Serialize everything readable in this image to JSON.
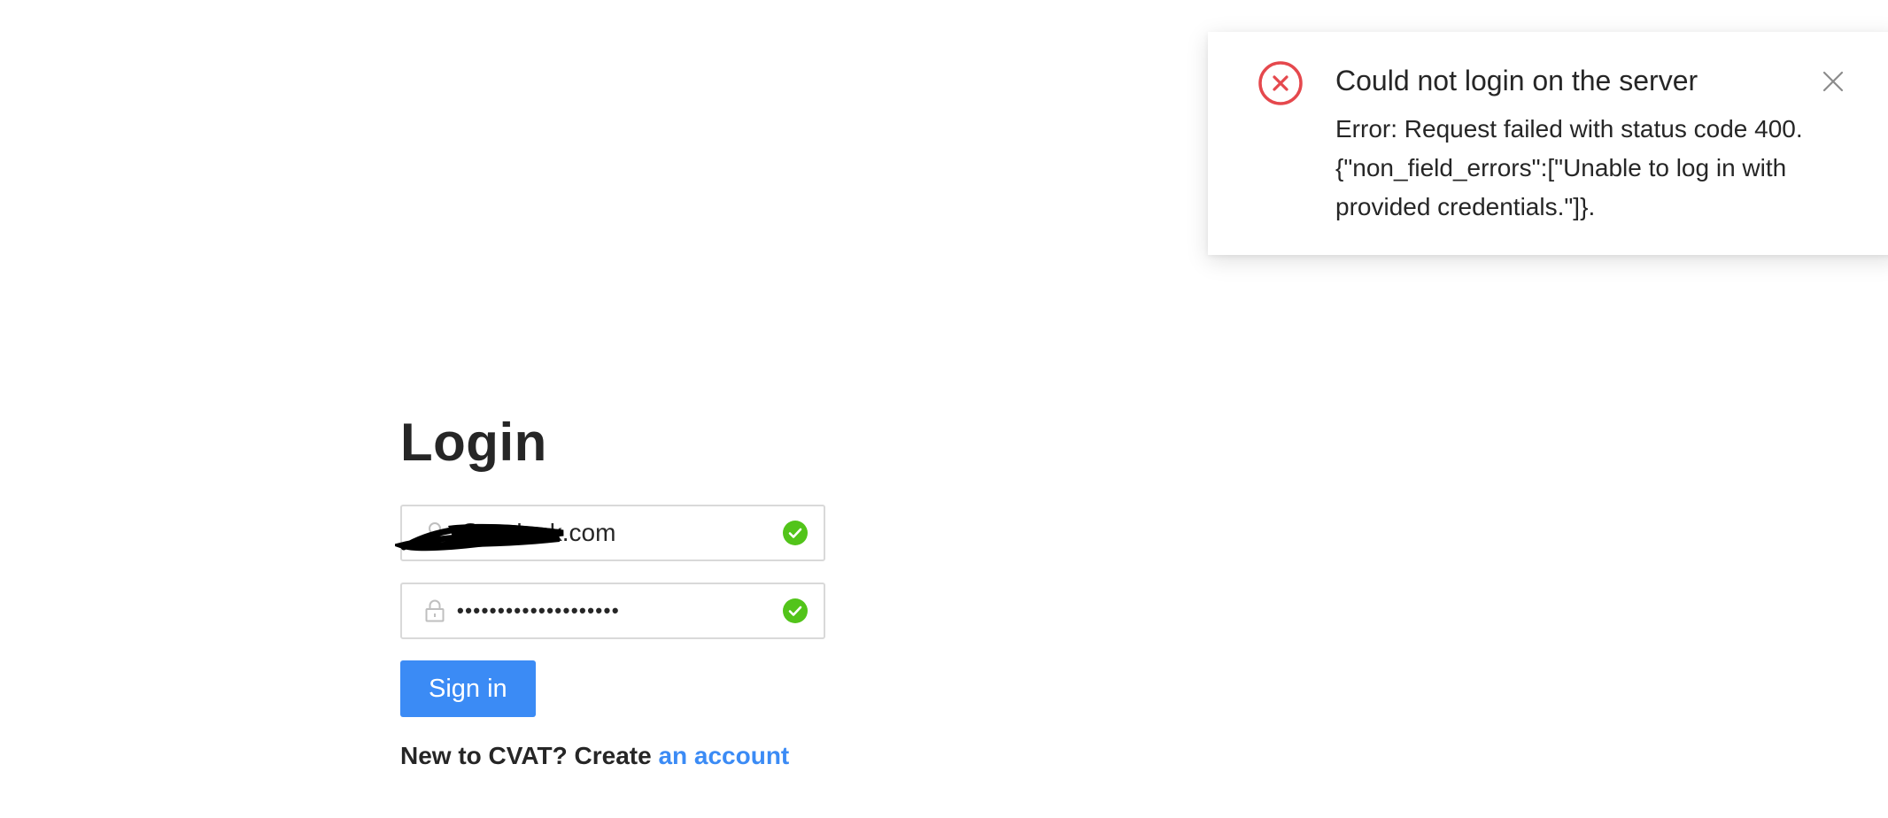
{
  "login": {
    "title": "Login",
    "username": {
      "value": "@outlook.com",
      "icon": "user-icon",
      "status_icon": "check-circle-icon"
    },
    "password": {
      "value": "••••••••••••••••••••",
      "icon": "lock-icon",
      "status_icon": "check-circle-icon"
    },
    "signin_label": "Sign in",
    "signup_text": "New to CVAT? Create ",
    "signup_link": "an account"
  },
  "notification": {
    "icon": "close-circle-icon",
    "title": "Could not login on the server",
    "body_lines": [
      "Error: Request failed with status code 400.",
      "{\"non_field_errors\":[\"Unable to log in with",
      "provided credentials.\"]}."
    ],
    "close_icon": "close-icon"
  },
  "colors": {
    "primary": "#3b8bf5",
    "success": "#52c41a",
    "error": "#e5484d",
    "text": "#262626",
    "border": "#d9d9d9"
  }
}
